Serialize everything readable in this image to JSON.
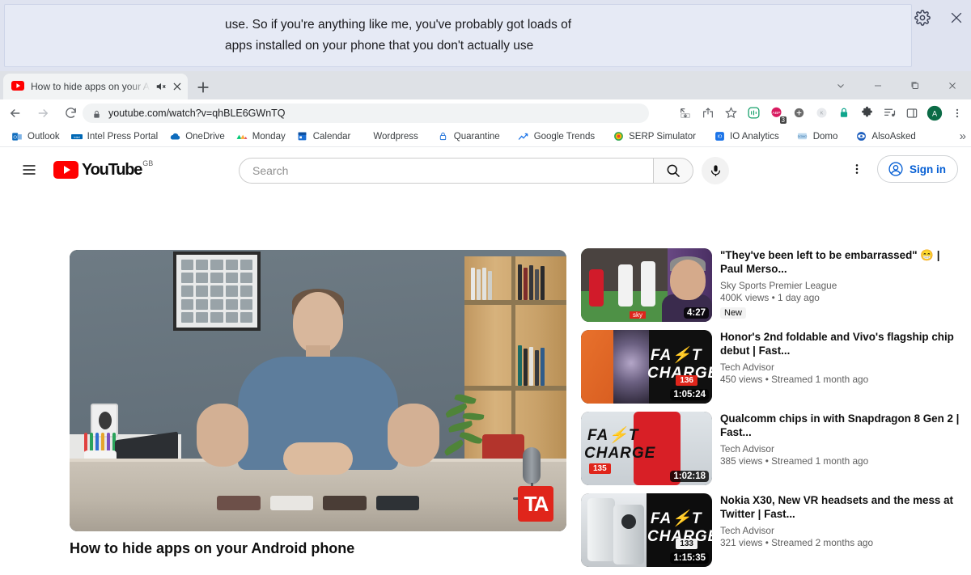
{
  "caption_overlay": {
    "text": "use. So if you're anything like me, you've probably got loads of\napps installed on your phone that you don't actually use",
    "settings_icon": "gear-icon",
    "close_icon": "close-icon"
  },
  "browser": {
    "tab": {
      "favicon": "youtube-favicon",
      "title": "How to hide apps on your A",
      "mute_icon": "speaker-mute-icon",
      "close_icon": "close-icon"
    },
    "new_tab_label": "+",
    "window_controls": [
      "chevron-down",
      "minimize",
      "restore",
      "close"
    ],
    "nav": {
      "back": "back-arrow-icon",
      "forward": "forward-arrow-icon",
      "reload": "reload-icon"
    },
    "omnibox": {
      "url": "youtube.com/watch?v=qhBLE6GWnTQ",
      "lock_icon": "lock-icon"
    },
    "toolbar_icons": [
      "install-page-icon",
      "share-icon",
      "bookmark-star-icon",
      "grammarly-extension-icon",
      "adblock-extension-icon",
      "extension-dark-icon",
      "extension-grey-icon",
      "lock-green-icon",
      "extensions-puzzle-icon",
      "reading-list-icon",
      "side-panel-icon",
      "profile-avatar-icon",
      "chrome-menu-icon"
    ],
    "adblock_count": "3",
    "profile_initial": "A",
    "bookmarks": [
      {
        "label": "Outlook",
        "icon": "outlook-icon"
      },
      {
        "label": "Intel Press Portal",
        "icon": "intel-icon"
      },
      {
        "label": "OneDrive",
        "icon": "onedrive-icon"
      },
      {
        "label": "Monday",
        "icon": "monday-icon"
      },
      {
        "label": "Calendar",
        "icon": "calendar-icon"
      },
      {
        "label": "Wordpress",
        "icon": "none"
      },
      {
        "label": "Quarantine",
        "icon": "lock-icon"
      },
      {
        "label": "Google Trends",
        "icon": "trends-icon"
      },
      {
        "label": "SERP Simulator",
        "icon": "serp-icon"
      },
      {
        "label": "IO Analytics",
        "icon": "io-icon"
      },
      {
        "label": "Domo",
        "icon": "domo-icon"
      },
      {
        "label": "AlsoAsked",
        "icon": "alsoasked-icon"
      }
    ],
    "bookmarks_overflow": "»"
  },
  "youtube": {
    "menu_icon": "hamburger-menu-icon",
    "logo_text": "YouTube",
    "logo_country": "GB",
    "search": {
      "placeholder": "Search",
      "button_icon": "search-icon",
      "mic_icon": "microphone-icon"
    },
    "settings_icon": "kebab-menu-icon",
    "sign_in_label": "Sign in",
    "sign_in_icon": "account-circle-icon",
    "video_title": "How to hide apps on your Android phone",
    "player_watermark": "TA",
    "recommendations": [
      {
        "title": "\"They've been left to be embarrassed\" 😁 | Paul Merso...",
        "channel": "Sky Sports Premier League",
        "stats": "400K views  •  1 day ago",
        "duration": "4:27",
        "badge": "New",
        "thumb": "football"
      },
      {
        "title": "Honor's 2nd foldable and Vivo's flagship chip debut | Fast...",
        "channel": "Tech Advisor",
        "stats": "450 views  •  Streamed 1 month ago",
        "duration": "1:05:24",
        "episode": "136",
        "thumb": "fastcharge-orange",
        "fc_line1": "FA⚡T",
        "fc_line2": "CHARGE"
      },
      {
        "title": "Qualcomm chips in with Snapdragon 8 Gen 2 | Fast...",
        "channel": "Tech Advisor",
        "stats": "385 views  •  Streamed 1 month ago",
        "duration": "1:02:18",
        "episode": "135",
        "thumb": "fastcharge-red",
        "fc_line1": "FA⚡T",
        "fc_line2": "CHARGE"
      },
      {
        "title": "Nokia X30, New VR headsets and the mess at Twitter | Fast...",
        "channel": "Tech Advisor",
        "stats": "321 views  •  Streamed 2 months ago",
        "duration": "1:15:35",
        "episode": "133",
        "thumb": "fastcharge-nokia",
        "fc_line1": "FA⚡T",
        "fc_line2": "CHARGE"
      }
    ]
  },
  "colors": {
    "youtube_red": "#ff0000",
    "signin_blue": "#065fd4",
    "caption_bg": "#e6eaf5",
    "chrome_tabstrip": "#dee1e6",
    "ta_red": "#e0251b"
  }
}
